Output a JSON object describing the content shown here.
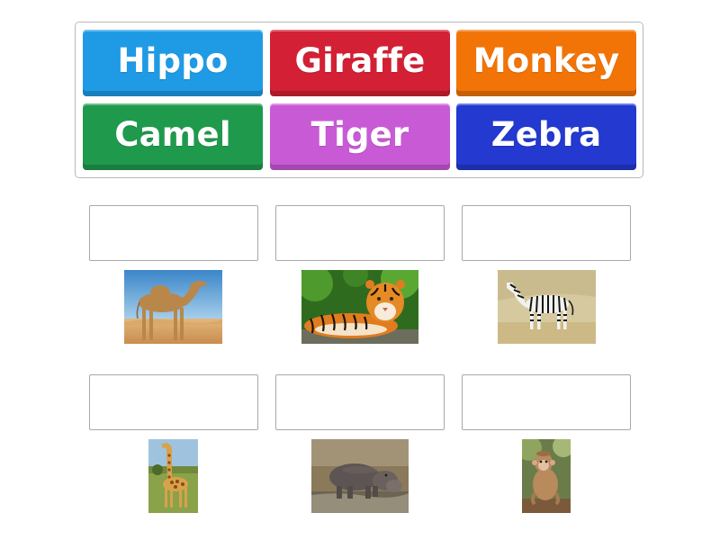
{
  "tiles": [
    {
      "label": "Hippo",
      "color": "#1f9be6"
    },
    {
      "label": "Giraffe",
      "color": "#d42034"
    },
    {
      "label": "Monkey",
      "color": "#f27407"
    },
    {
      "label": "Camel",
      "color": "#1f9a4d"
    },
    {
      "label": "Tiger",
      "color": "#c95ad6"
    },
    {
      "label": "Zebra",
      "color": "#2339d0"
    }
  ],
  "targets": [
    {
      "image": "camel-photo",
      "answer": ""
    },
    {
      "image": "tiger-photo",
      "answer": ""
    },
    {
      "image": "zebra-photo",
      "answer": ""
    },
    {
      "image": "giraffe-photo",
      "answer": ""
    },
    {
      "image": "hippo-photo",
      "answer": ""
    },
    {
      "image": "monkey-photo",
      "answer": ""
    }
  ]
}
